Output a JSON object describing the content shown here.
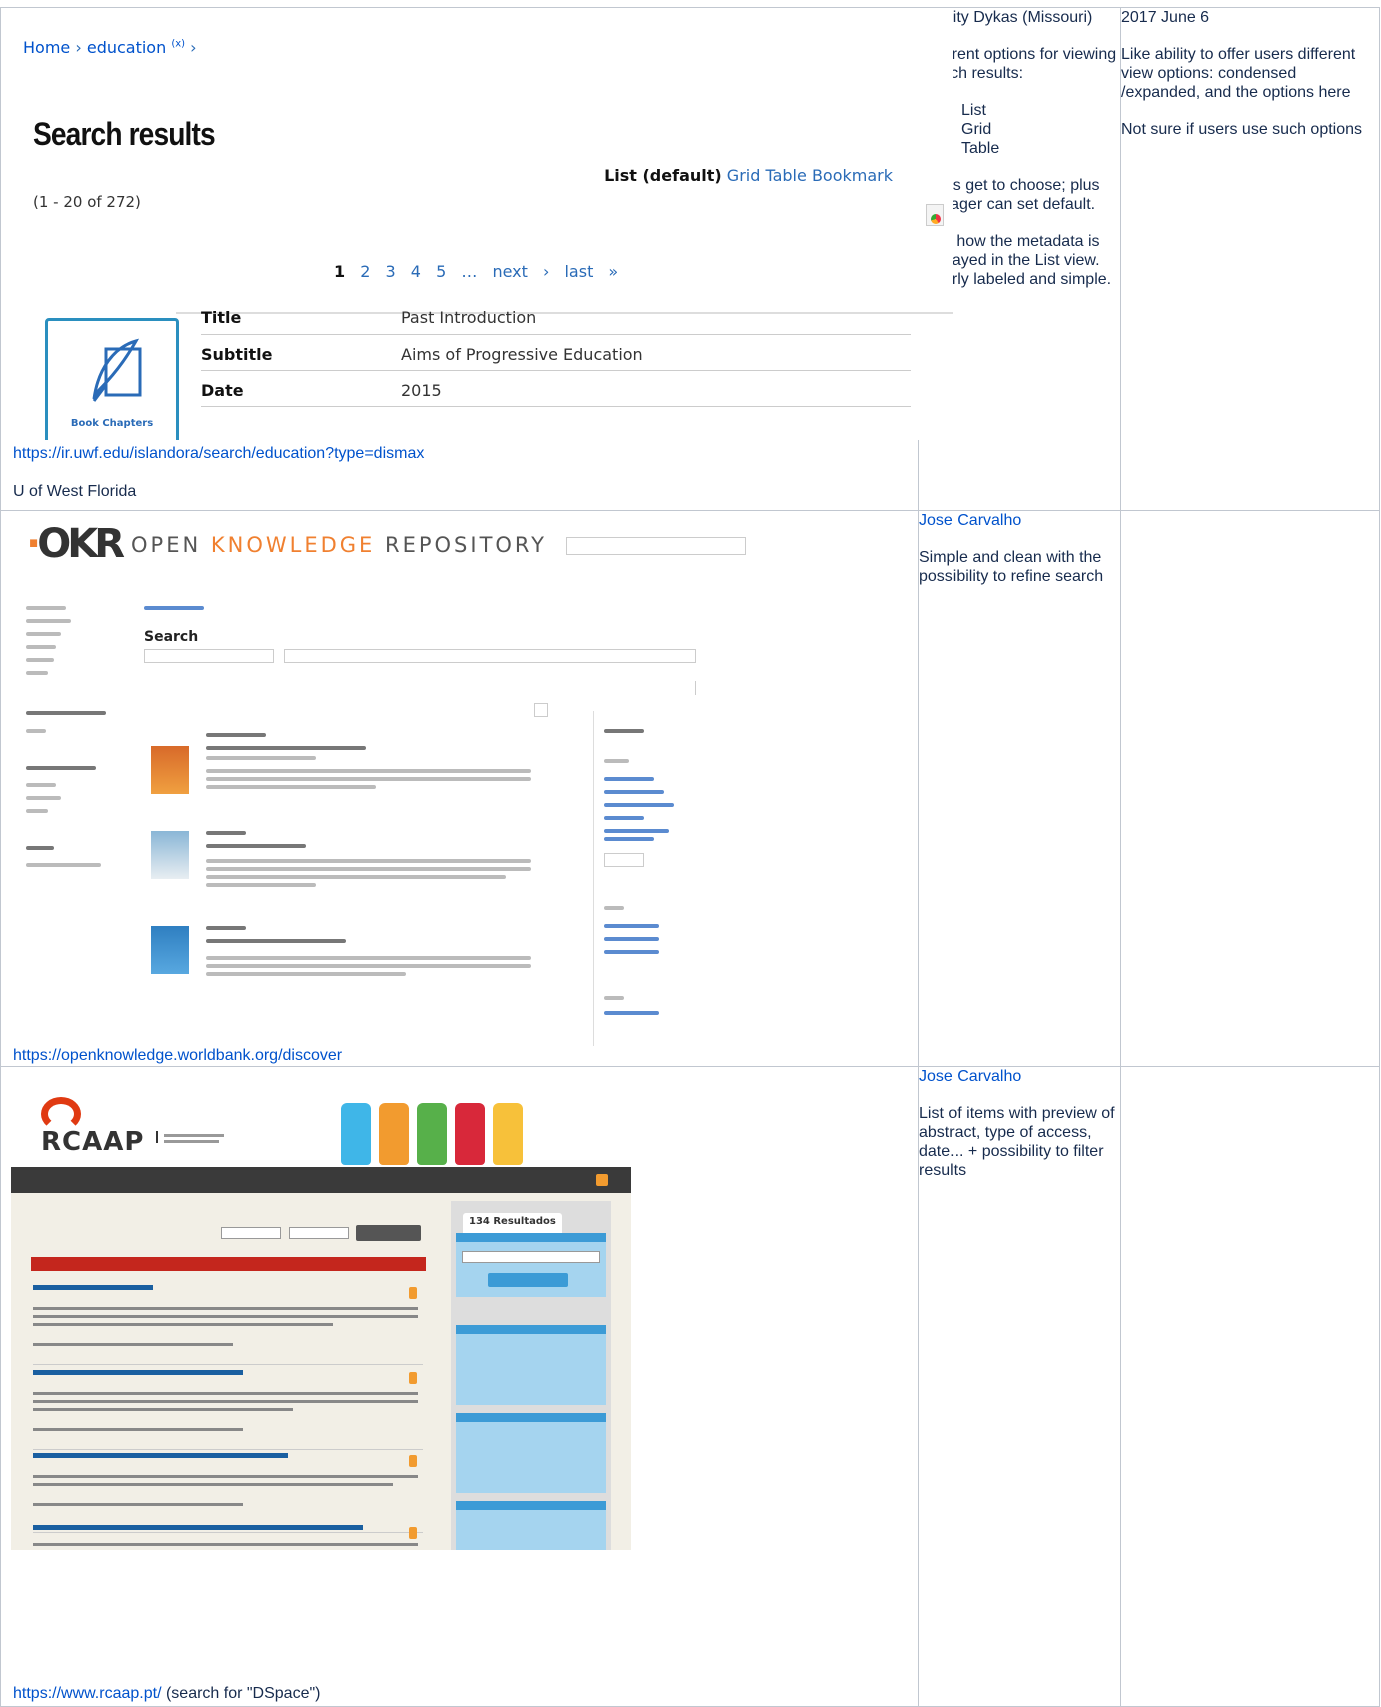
{
  "rows": [
    {
      "uwf": {
        "breadcrumb": {
          "home": "Home",
          "sep1": "›",
          "section": "education",
          "remove": "(x)",
          "sep2": "›"
        },
        "title": "Search results",
        "view_label_default": "List (default)",
        "view_links": [
          "Grid",
          "Table",
          "Bookmark"
        ],
        "result_count": "(1 - 20 of 272)",
        "pager": {
          "current": "1",
          "pages": [
            "2",
            "3",
            "4",
            "5"
          ],
          "ellipsis": "…",
          "next": "next ›",
          "last": "last »"
        },
        "item": {
          "thumb_caption": "Book Chapters",
          "fields": [
            {
              "label": "Title",
              "value": "Past Introduction"
            },
            {
              "label": "Subtitle",
              "value": "Aims of Progressive Education"
            },
            {
              "label": "Date",
              "value": "2015"
            }
          ]
        }
      },
      "source_url": "https://ir.uwf.edu/islandora/search/education?type=dismax",
      "source_name": "U of West Florida",
      "reviewer": "Felicity Dykas (Missouri)",
      "note_intro": "Different options for viewing search results:",
      "note_list": [
        "List",
        "Grid",
        "Table"
      ],
      "note_p2": "Users get to choose; plus manager can set default.",
      "note_p3": "I like how the metadata is displayed in the List view. Clearly labeled and simple.",
      "date": "2017 June 6",
      "comment_p1": "Like ability to offer users different view options: condensed /expanded, and the options here",
      "comment_p2": "Not sure if users use such options"
    },
    {
      "okr": {
        "logo": "OKR",
        "brand_a": "OPEN ",
        "brand_b": "KNOWLEDGE",
        "brand_c": " REPOSITORY",
        "search_title": "Search"
      },
      "source_url": "https://openknowledge.worldbank.org/discover",
      "reviewer": "Jose Carvalho",
      "note": "Simple and clean with the possibility to refine search"
    },
    {
      "rcaap": {
        "logo": "RCAAP",
        "side_title": "134 Resultados"
      },
      "source_url": "https://www.rcaap.pt/",
      "source_suffix": " (search for \"DSpace\")",
      "reviewer": "Jose Carvalho",
      "note": "List of items with preview of abstract, type of access, date... + possibility to filter results"
    }
  ],
  "colors": {
    "link": "#0052cc",
    "uwf_link": "#2a6bb7",
    "okr_accent": "#f08030",
    "rcaap_red": "#c4261d",
    "rcaap_blue": "#3c9bd6"
  }
}
